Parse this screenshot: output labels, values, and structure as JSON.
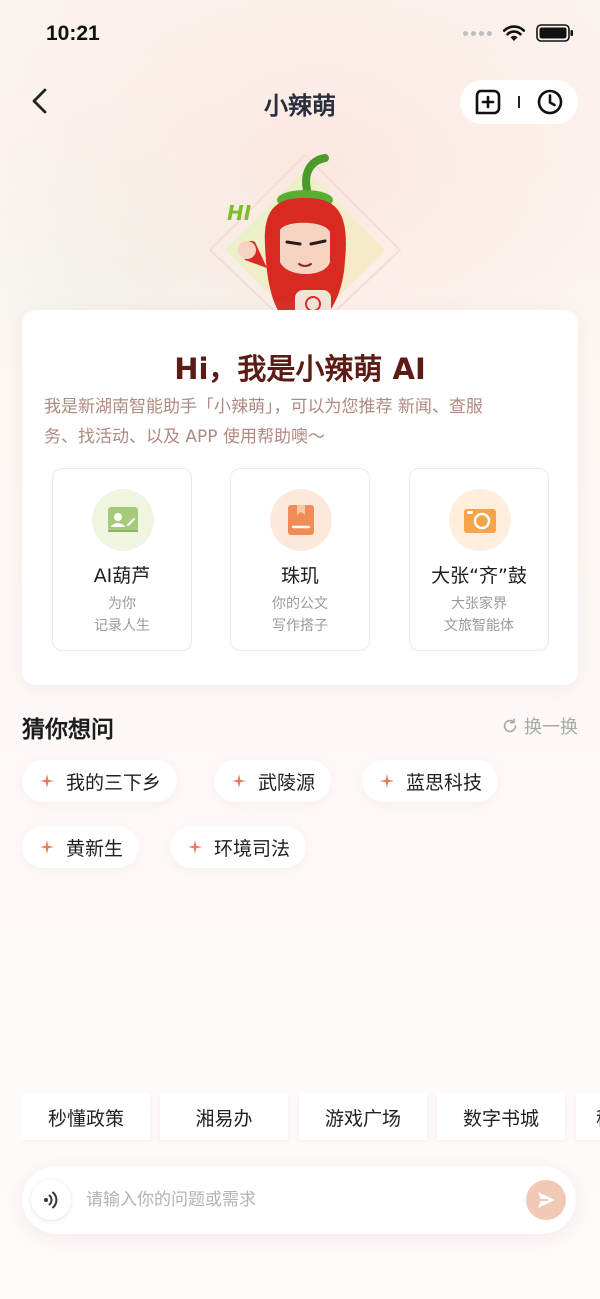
{
  "status_bar": {
    "time": "10:21"
  },
  "nav": {
    "title": "小辣萌"
  },
  "welcome": {
    "title": "Hi，我是小辣萌 AI",
    "intro_line1": "我是新湖南智能助手「小辣萌」，可以为您推荐 新闻、查服",
    "intro_line2": "务、找活动、以及 APP 使用帮助噢～"
  },
  "features": [
    {
      "name": "AI葫芦",
      "desc_line1": "为你",
      "desc_line2": "记录人生",
      "icon": "id-card-icon",
      "color": "#bfd89c"
    },
    {
      "name": "珠玑",
      "desc_line1": "你的公文",
      "desc_line2": "写作搭子",
      "icon": "bookmark-icon",
      "color": "#f4a56f"
    },
    {
      "name": "大张“齐”鼓",
      "desc_line1": "大张家界",
      "desc_line2": "文旅智能体",
      "icon": "camera-icon",
      "color": "#f8b365"
    }
  ],
  "suggestions": {
    "title": "猜你想问",
    "refresh_label": "换一换",
    "items": [
      "我的三下乡",
      "武陵源",
      "蓝思科技",
      "黄新生",
      "环境司法"
    ]
  },
  "shortcuts": [
    "秒懂政策",
    "湘易办",
    "游戏广场",
    "数字书城",
    "移"
  ],
  "input": {
    "placeholder": "请输入你的问题或需求"
  },
  "colors": {
    "accent": "#e8523e",
    "title": "#5c1c15",
    "send_button": "#f1c9b4"
  }
}
